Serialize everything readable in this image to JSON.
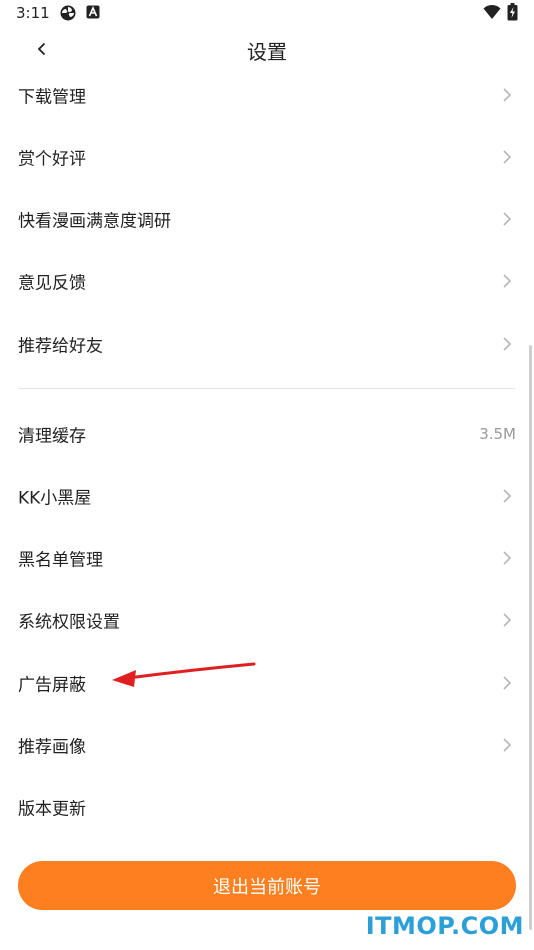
{
  "status_bar": {
    "time": "3:11",
    "icons": [
      "fan-icon",
      "a-icon",
      "wifi-icon",
      "battery-charging-icon"
    ]
  },
  "header": {
    "title": "设置",
    "back_icon": "chevron-left-icon"
  },
  "group1": [
    {
      "label": "下载管理"
    },
    {
      "label": "赏个好评"
    },
    {
      "label": "快看漫画满意度调研"
    },
    {
      "label": "意见反馈"
    },
    {
      "label": "推荐给好友"
    }
  ],
  "group2": [
    {
      "label": "清理缓存",
      "value": "3.5M"
    },
    {
      "label": "KK小黑屋"
    },
    {
      "label": "黑名单管理"
    },
    {
      "label": "系统权限设置"
    },
    {
      "label": "广告屏蔽"
    },
    {
      "label": "推荐画像"
    },
    {
      "label": "版本更新"
    }
  ],
  "logout_label": "退出当前账号",
  "watermark": "ITMOP.COM",
  "colors": {
    "accent": "#fd7f1f",
    "annotation_arrow": "#e02020",
    "watermark": "#2c9fd9",
    "chevron": "#b5b5b5"
  }
}
